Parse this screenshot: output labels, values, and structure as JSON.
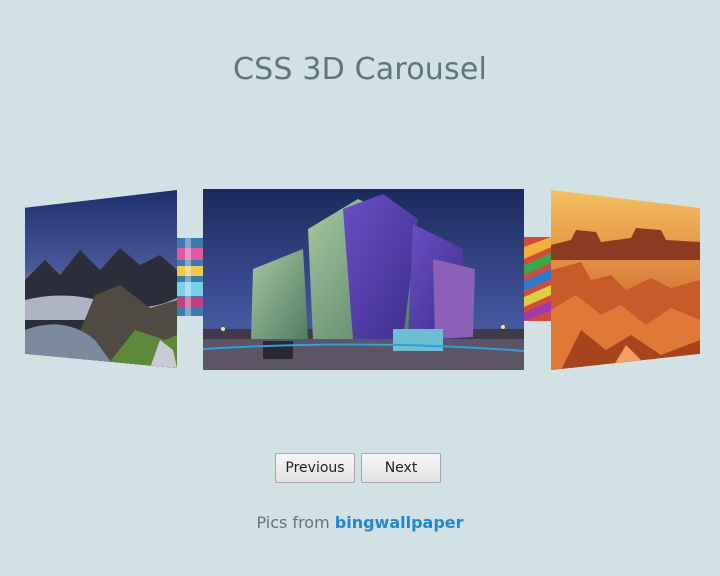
{
  "header": {
    "title": "CSS 3D Carousel"
  },
  "carousel": {
    "slides": [
      {
        "name": "mountain-sunset",
        "position": "left"
      },
      {
        "name": "colorful-abstract",
        "position": "left-inner"
      },
      {
        "name": "titanic-building",
        "position": "center"
      },
      {
        "name": "rainbow-stripes",
        "position": "right-inner"
      },
      {
        "name": "canyon-desert",
        "position": "right"
      }
    ]
  },
  "controls": {
    "previous_label": "Previous",
    "next_label": "Next"
  },
  "footer": {
    "credit_prefix": "Pics from ",
    "credit_link": "bingwallpaper"
  },
  "colors": {
    "background": "#d2e1e3",
    "title": "#5f7777",
    "link": "#1e88d8"
  }
}
